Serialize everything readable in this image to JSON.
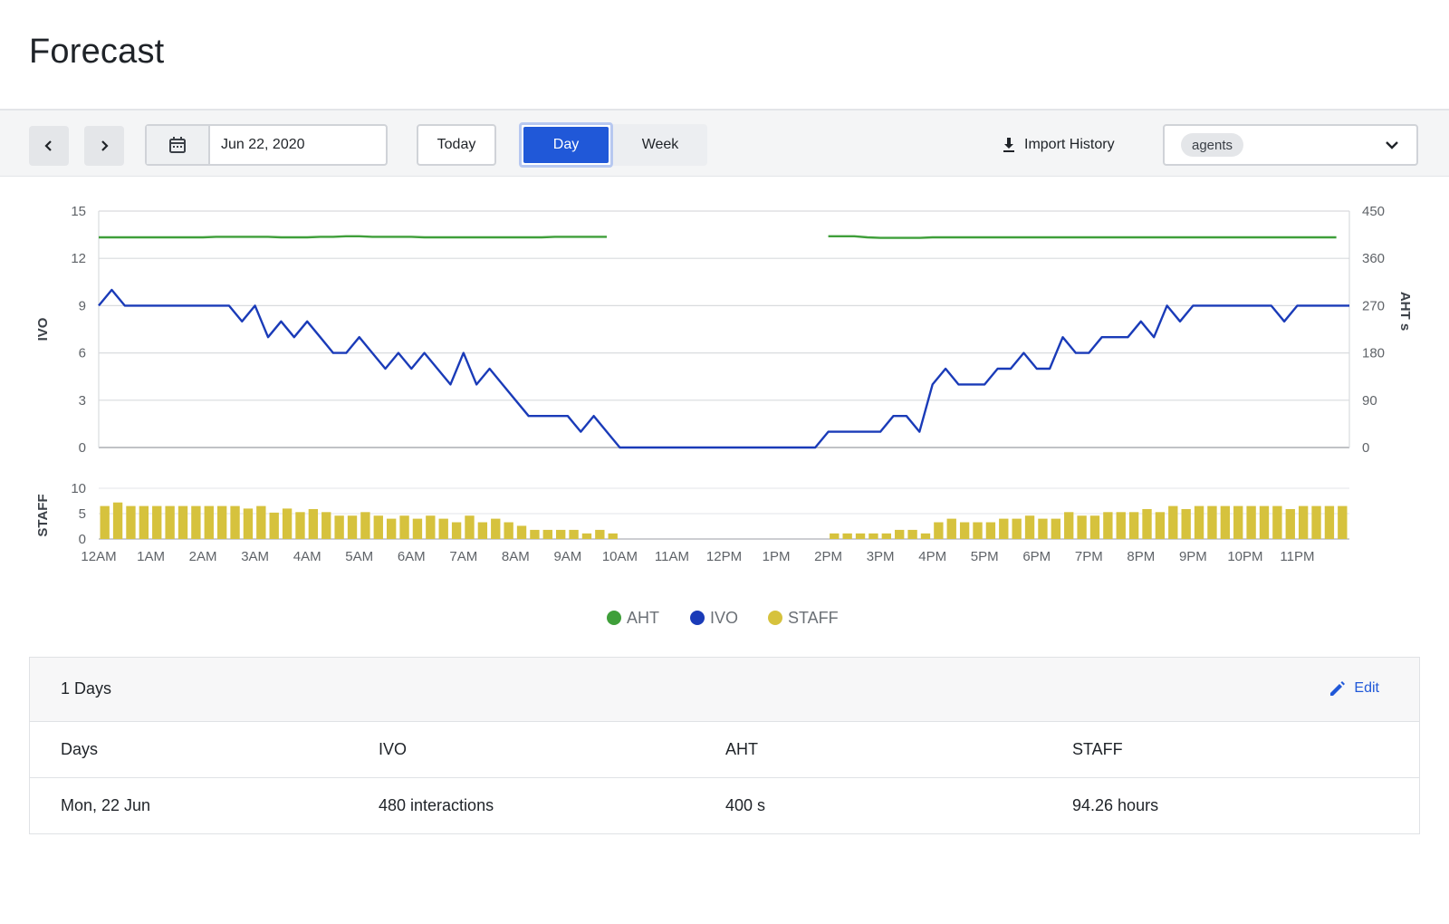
{
  "page": {
    "title": "Forecast"
  },
  "toolbar": {
    "prev_icon": "chevron-left-icon",
    "next_icon": "chevron-right-icon",
    "calendar_icon": "calendar-icon",
    "date_value": "Jun 22, 2020",
    "today_label": "Today",
    "view_modes": [
      "Day",
      "Week"
    ],
    "selected_view": "Day",
    "import_label": "Import History",
    "import_icon": "download-icon",
    "select_chip": "agents",
    "select_icon": "chevron-down-icon"
  },
  "colors": {
    "accent": "#2058d8",
    "aht": "#3f9f3a",
    "ivo": "#1a3bb8",
    "staff": "#d6c23d"
  },
  "chart_data": {
    "type": "line",
    "x": [
      "12AM",
      "1AM",
      "2AM",
      "3AM",
      "4AM",
      "5AM",
      "6AM",
      "7AM",
      "8AM",
      "9AM",
      "10AM",
      "11AM",
      "12PM",
      "1PM",
      "2PM",
      "3PM",
      "4PM",
      "5PM",
      "6PM",
      "7PM",
      "8PM",
      "9PM",
      "10PM",
      "11PM"
    ],
    "ylabel_left": "IVO",
    "ylabel_right": "AHT s",
    "ylim_left": [
      0,
      15
    ],
    "yticks_left": [
      0,
      3,
      6,
      9,
      12,
      15
    ],
    "ylim_right": [
      0,
      450
    ],
    "yticks_right": [
      0,
      90,
      180,
      270,
      360,
      450
    ],
    "grid": true,
    "legend_position": "bottom",
    "legend": [
      "AHT",
      "IVO",
      "STAFF"
    ],
    "series": [
      {
        "name": "AHT",
        "axis": "right",
        "color": "#3f9f3a",
        "values": [
          400,
          400,
          400,
          400,
          400,
          400,
          400,
          400,
          400,
          401,
          401,
          401,
          401,
          401,
          400,
          400,
          400,
          401,
          401,
          402,
          402,
          401,
          401,
          401,
          401,
          400,
          400,
          400,
          400,
          400,
          400,
          400,
          400,
          400,
          400,
          401,
          401,
          401,
          401,
          401,
          null,
          null,
          null,
          null,
          null,
          null,
          null,
          null,
          null,
          null,
          null,
          null,
          null,
          null,
          null,
          null,
          402,
          402,
          402,
          400,
          399,
          399,
          399,
          399,
          400,
          400,
          400,
          400,
          400,
          400,
          400,
          400,
          400,
          400,
          400,
          400,
          400,
          400,
          400,
          400,
          400,
          400,
          400,
          400,
          400,
          400,
          400,
          400,
          400,
          400,
          400,
          400,
          400,
          400,
          400,
          400
        ]
      },
      {
        "name": "IVO",
        "axis": "left",
        "color": "#1a3bb8",
        "values": [
          9,
          10,
          9,
          9,
          9,
          9,
          9,
          9,
          9,
          9,
          9,
          8,
          9,
          7,
          8,
          7,
          8,
          7,
          6,
          6,
          7,
          6,
          5,
          6,
          5,
          6,
          5,
          4,
          6,
          4,
          5,
          4,
          3,
          2,
          2,
          2,
          2,
          1,
          2,
          1,
          0,
          0,
          0,
          0,
          0,
          0,
          0,
          0,
          0,
          0,
          0,
          0,
          0,
          0,
          0,
          0,
          1,
          1,
          1,
          1,
          1,
          2,
          2,
          1,
          4,
          5,
          4,
          4,
          4,
          5,
          5,
          6,
          5,
          5,
          7,
          6,
          6,
          7,
          7,
          7,
          8,
          7,
          9,
          8,
          9,
          9,
          9,
          9,
          9,
          9,
          9,
          8,
          9,
          9,
          9,
          9,
          9
        ]
      },
      {
        "name": "STAFF",
        "axis": "staff",
        "color": "#d6c23d",
        "ylabel": "STAFF",
        "ylim": [
          0,
          10
        ],
        "yticks": [
          0,
          5,
          10
        ],
        "values": [
          6.5,
          7.2,
          6.5,
          6.5,
          6.5,
          6.5,
          6.5,
          6.5,
          6.5,
          6.5,
          6.5,
          6,
          6.5,
          5.2,
          6,
          5.3,
          5.9,
          5.3,
          4.6,
          4.6,
          5.3,
          4.6,
          4,
          4.6,
          4,
          4.6,
          4,
          3.3,
          4.6,
          3.3,
          4,
          3.3,
          2.6,
          1.8,
          1.8,
          1.8,
          1.8,
          1.1,
          1.8,
          1.1,
          0,
          0,
          0,
          0,
          0,
          0,
          0,
          0,
          0,
          0,
          0,
          0,
          0,
          0,
          0,
          0,
          1.1,
          1.1,
          1.1,
          1.1,
          1.1,
          1.8,
          1.8,
          1.1,
          3.3,
          4,
          3.3,
          3.3,
          3.3,
          4,
          4,
          4.6,
          4,
          4,
          5.3,
          4.6,
          4.6,
          5.3,
          5.3,
          5.3,
          5.9,
          5.3,
          6.5,
          5.9,
          6.5,
          6.5,
          6.5,
          6.5,
          6.5,
          6.5,
          6.5,
          5.9,
          6.5,
          6.5,
          6.5,
          6.5
        ]
      }
    ]
  },
  "summary": {
    "title": "1 Days",
    "edit_label": "Edit",
    "edit_icon": "pencil-icon",
    "columns": [
      "Days",
      "IVO",
      "AHT",
      "STAFF"
    ],
    "rows": [
      [
        "Mon, 22 Jun",
        "480 interactions",
        "400 s",
        "94.26 hours"
      ]
    ]
  }
}
